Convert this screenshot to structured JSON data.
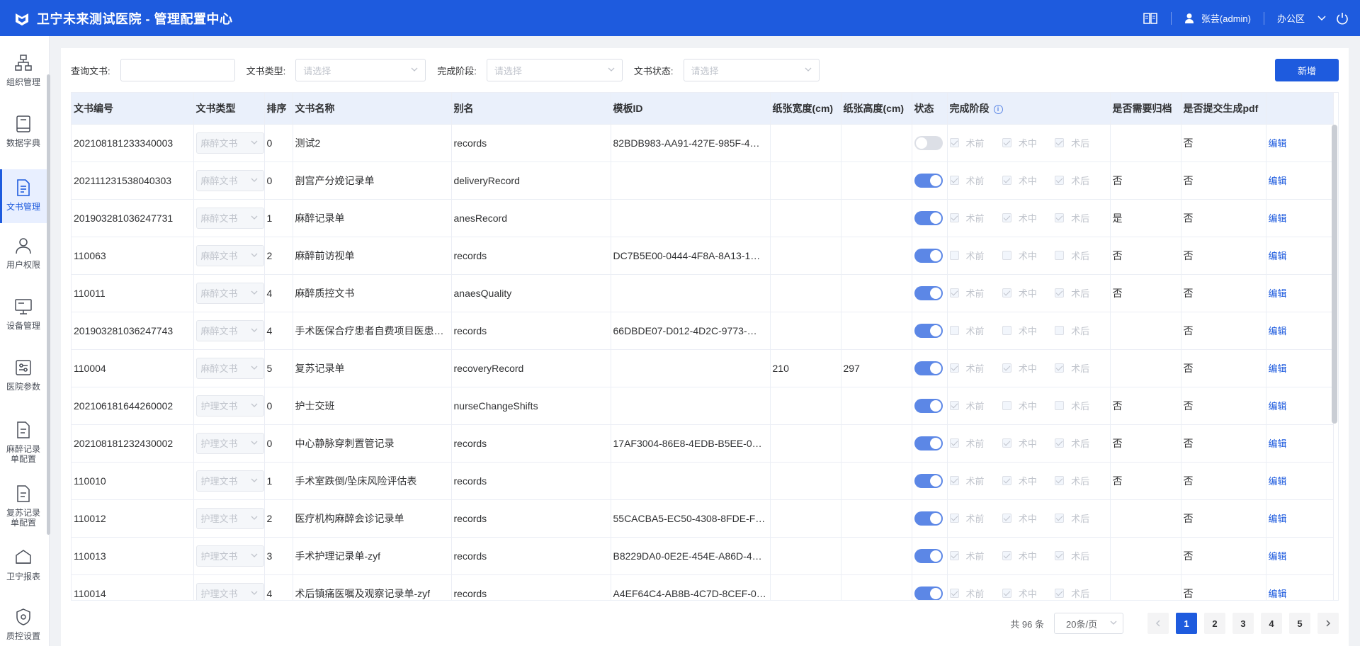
{
  "header": {
    "title": "卫宁未来测试医院 - 管理配置中心",
    "user": "张芸(admin)",
    "area": "办公区",
    "icons": [
      "book-icon",
      "user-icon",
      "chevron-down-icon",
      "power-icon"
    ]
  },
  "sidebar": {
    "items": [
      {
        "label": "组织管理",
        "icon": "org-icon"
      },
      {
        "label": "数据字典",
        "icon": "dictionary-icon"
      },
      {
        "label": "文书管理",
        "icon": "document-icon",
        "active": true
      },
      {
        "label": "用户权限",
        "icon": "users-icon"
      },
      {
        "label": "设备管理",
        "icon": "monitor-icon"
      },
      {
        "label": "医院参数",
        "icon": "settings-icon"
      },
      {
        "label": "麻醉记录单配置",
        "icon": "record-icon"
      },
      {
        "label": "复苏记录单配置",
        "icon": "record-icon"
      },
      {
        "label": "卫宁报表",
        "icon": "report-icon"
      },
      {
        "label": "质控设置",
        "icon": "shield-icon"
      }
    ]
  },
  "filters": {
    "query_label": "查询文书:",
    "query_value": "",
    "type_label": "文书类型:",
    "type_placeholder": "请选择",
    "stage_label": "完成阶段:",
    "stage_placeholder": "请选择",
    "status_label": "文书状态:",
    "status_placeholder": "请选择",
    "new_button": "新增"
  },
  "table": {
    "headers": {
      "code": "文书编号",
      "type": "文书类型",
      "order": "排序",
      "name": "文书名称",
      "alias": "别名",
      "template": "模板ID",
      "width": "纸张宽度(cm)",
      "height": "纸张高度(cm)",
      "status": "状态",
      "stage": "完成阶段",
      "archive": "是否需要归档",
      "pdf": "是否提交生成pdf"
    },
    "stage_labels": [
      "术前",
      "术中",
      "术后"
    ],
    "edit_label": "编辑",
    "rows": [
      {
        "code": "202108181233340003",
        "type": "麻醉文书",
        "order": "0",
        "name": "测试2",
        "alias": "records",
        "template": "82BDB983-AA91-427E-985F-4…",
        "width": "",
        "height": "",
        "status": "off",
        "stages": [
          true,
          true,
          true
        ],
        "archive": "",
        "pdf": "否"
      },
      {
        "code": "202111231538040303",
        "type": "麻醉文书",
        "order": "0",
        "name": "剖宫产分娩记录单",
        "alias": "deliveryRecord",
        "template": "",
        "width": "",
        "height": "",
        "status": "on",
        "stages": [
          true,
          true,
          true
        ],
        "archive": "否",
        "pdf": "否"
      },
      {
        "code": "201903281036247731",
        "type": "麻醉文书",
        "order": "1",
        "name": "麻醉记录单",
        "alias": "anesRecord",
        "template": "",
        "width": "",
        "height": "",
        "status": "on",
        "stages": [
          true,
          true,
          true
        ],
        "archive": "是",
        "pdf": "否"
      },
      {
        "code": "110063",
        "type": "麻醉文书",
        "order": "2",
        "name": "麻醉前访视单",
        "alias": "records",
        "template": "DC7B5E00-0444-4F8A-8A13-1…",
        "width": "",
        "height": "",
        "status": "on",
        "stages": [
          false,
          false,
          false
        ],
        "archive": "否",
        "pdf": "否"
      },
      {
        "code": "110011",
        "type": "麻醉文书",
        "order": "4",
        "name": "麻醉质控文书",
        "alias": "anaesQuality",
        "template": "",
        "width": "",
        "height": "",
        "status": "on",
        "stages": [
          true,
          true,
          true
        ],
        "archive": "否",
        "pdf": "否"
      },
      {
        "code": "201903281036247743",
        "type": "麻醉文书",
        "order": "4",
        "name": "手术医保合疗患者自费项目医患…",
        "alias": "records",
        "template": "66DBDE07-D012-4D2C-9773-…",
        "width": "",
        "height": "",
        "status": "on",
        "stages": [
          false,
          false,
          false
        ],
        "archive": "",
        "pdf": "否"
      },
      {
        "code": "110004",
        "type": "麻醉文书",
        "order": "5",
        "name": "复苏记录单",
        "alias": "recoveryRecord",
        "template": "",
        "width": "210",
        "height": "297",
        "status": "on",
        "stages": [
          true,
          true,
          true
        ],
        "archive": "",
        "pdf": "否"
      },
      {
        "code": "202106181644260002",
        "type": "护理文书",
        "order": "0",
        "name": "护士交班",
        "alias": "nurseChangeShifts",
        "template": "",
        "width": "",
        "height": "",
        "status": "on",
        "stages": [
          true,
          false,
          false
        ],
        "archive": "否",
        "pdf": "否"
      },
      {
        "code": "202108181232430002",
        "type": "护理文书",
        "order": "0",
        "name": "中心静脉穿刺置管记录",
        "alias": "records",
        "template": "17AF3004-86E8-4EDB-B5EE-0…",
        "width": "",
        "height": "",
        "status": "on",
        "stages": [
          true,
          true,
          true
        ],
        "archive": "否",
        "pdf": "否"
      },
      {
        "code": "110010",
        "type": "护理文书",
        "order": "1",
        "name": "手术室跌倒/坠床风险评估表",
        "alias": "records",
        "template": "",
        "width": "",
        "height": "",
        "status": "on",
        "stages": [
          true,
          true,
          true
        ],
        "archive": "否",
        "pdf": "否"
      },
      {
        "code": "110012",
        "type": "护理文书",
        "order": "2",
        "name": "医疗机构麻醉会诊记录单",
        "alias": "records",
        "template": "55CACBA5-EC50-4308-8FDE-F…",
        "width": "",
        "height": "",
        "status": "on",
        "stages": [
          true,
          true,
          true
        ],
        "archive": "",
        "pdf": "否"
      },
      {
        "code": "110013",
        "type": "护理文书",
        "order": "3",
        "name": "手术护理记录单-zyf",
        "alias": "records",
        "template": "B8229DA0-0E2E-454E-A86D-4…",
        "width": "",
        "height": "",
        "status": "on",
        "stages": [
          true,
          true,
          true
        ],
        "archive": "",
        "pdf": "否"
      },
      {
        "code": "110014",
        "type": "护理文书",
        "order": "4",
        "name": "术后镇痛医嘱及观察记录单-zyf",
        "alias": "records",
        "template": "A4EF64C4-AB8B-4C7D-8CEF-0…",
        "width": "",
        "height": "",
        "status": "on",
        "stages": [
          true,
          true,
          true
        ],
        "archive": "",
        "pdf": "否"
      }
    ]
  },
  "pagination": {
    "total": "共 96 条",
    "page_size": "20条/页",
    "pages": [
      "1",
      "2",
      "3",
      "4",
      "5"
    ],
    "current": "1"
  }
}
